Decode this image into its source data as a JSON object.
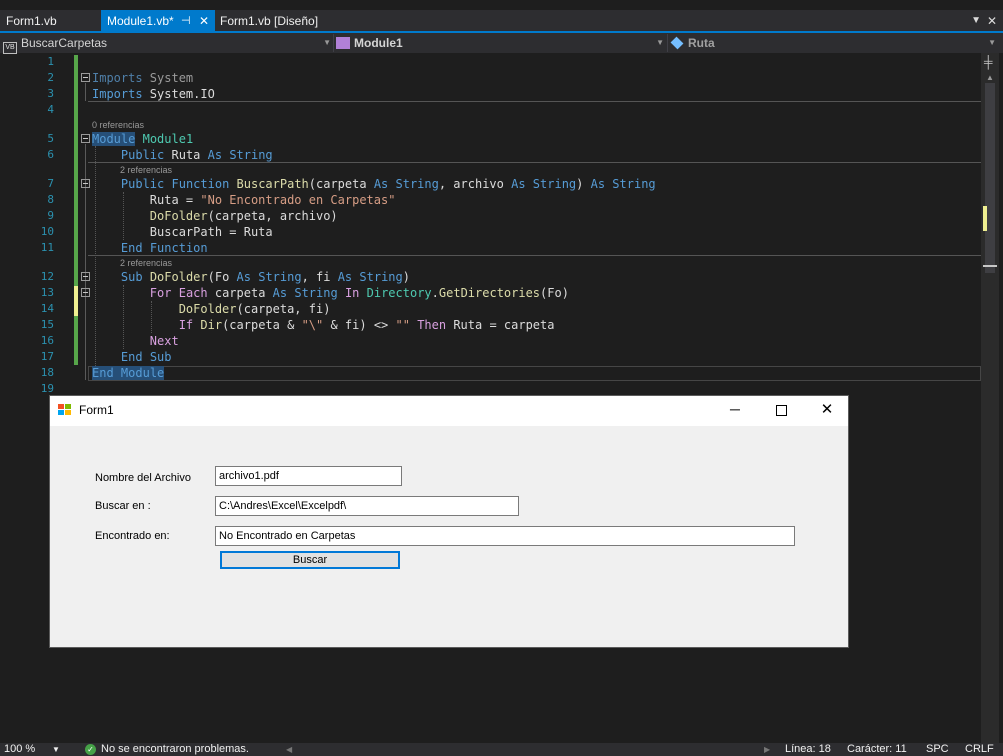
{
  "tabs": [
    {
      "label": "Form1.vb",
      "active": false
    },
    {
      "label": "Module1.vb*",
      "active": true
    },
    {
      "label": "Form1.vb [Diseño]",
      "active": false
    }
  ],
  "tab_icons": {
    "pin": "pin-icon",
    "close": "close-icon",
    "overflow": "chevron-down-icon"
  },
  "navbar": {
    "project_badge": "VB",
    "project": "BuscarCarpetas",
    "type": "Module1",
    "member": "Ruta"
  },
  "lines": [
    "1",
    "2",
    "3",
    "4",
    "5",
    "6",
    "7",
    "8",
    "9",
    "10",
    "11",
    "12",
    "13",
    "14",
    "15",
    "16",
    "17",
    "18",
    "19"
  ],
  "lenses": {
    "l5": "0 referencias",
    "l7": "2 referencias",
    "l12": "2 referencias"
  },
  "code": {
    "l2": [
      "Imports",
      " System"
    ],
    "l3": [
      "Imports",
      " System.IO"
    ],
    "l5": [
      "Module",
      " ",
      "Module1"
    ],
    "l6": [
      "    ",
      "Public",
      " Ruta ",
      "As",
      " ",
      "String"
    ],
    "l7": [
      "    ",
      "Public",
      " ",
      "Function",
      " ",
      "BuscarPath",
      "(carpeta ",
      "As",
      " ",
      "String",
      ", archivo ",
      "As",
      " ",
      "String",
      ") ",
      "As",
      " ",
      "String"
    ],
    "l8": [
      "        Ruta = ",
      "\"No Encontrado en Carpetas\""
    ],
    "l9": [
      "        ",
      "DoFolder",
      "(carpeta, archivo)"
    ],
    "l10": [
      "        BuscarPath = Ruta"
    ],
    "l11": [
      "    ",
      "End",
      " ",
      "Function"
    ],
    "l12": [
      "    ",
      "Sub",
      " ",
      "DoFolder",
      "(Fo ",
      "As",
      " ",
      "String",
      ", fi ",
      "As",
      " ",
      "String",
      ")"
    ],
    "l13": [
      "        ",
      "For",
      " ",
      "Each",
      " carpeta ",
      "As",
      " ",
      "String",
      " ",
      "In",
      " ",
      "Directory",
      ".",
      "GetDirectories",
      "(Fo)"
    ],
    "l14": [
      "            ",
      "DoFolder",
      "(carpeta, fi)"
    ],
    "l15": [
      "            ",
      "If",
      " ",
      "Dir",
      "(carpeta & ",
      "\"\\\"",
      " & fi) <> ",
      "\"\"",
      " ",
      "Then",
      " Ruta = carpeta"
    ],
    "l16": [
      "        ",
      "Next"
    ],
    "l17": [
      "    ",
      "End",
      " ",
      "Sub"
    ],
    "l18": [
      "End",
      " ",
      "Module"
    ]
  },
  "statusbar": {
    "zoom": "100 %",
    "message": "No se encontraron problemas.",
    "line": "Línea: 18",
    "char": "Carácter: 11",
    "spc": "SPC",
    "crlf": "CRLF"
  },
  "form": {
    "title": "Form1",
    "label_nombre": "Nombre del Archivo",
    "value_nombre": "archivo1.pdf",
    "label_buscar": "Buscar en :",
    "value_buscar": "C:\\Andres\\Excel\\Excelpdf\\",
    "label_encontrado": "Encontrado en:",
    "value_encontrado": "No Encontrado en Carpetas",
    "button": "Buscar"
  },
  "colors": {
    "accent": "#007acc",
    "keyword": "#569cd6",
    "control_keyword": "#d8a0df",
    "function": "#dcdcaa",
    "type": "#4ec9b0",
    "string": "#d69d85",
    "line_number": "#2b91af"
  }
}
